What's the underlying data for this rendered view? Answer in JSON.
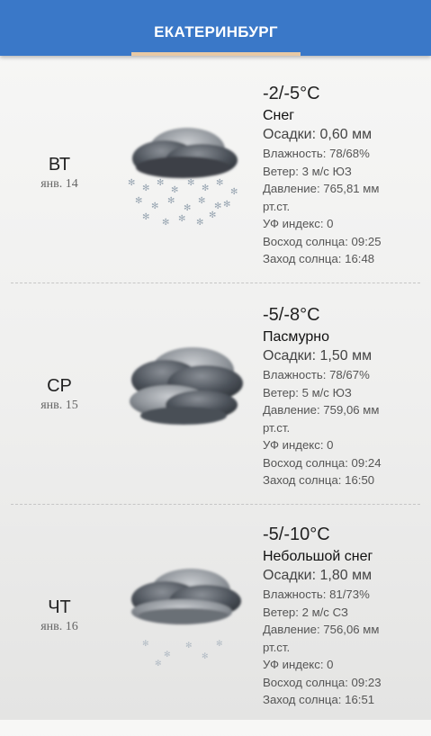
{
  "header": {
    "tab_label": "ЕКАТЕРИНБУРГ",
    "colors": {
      "bar": "#3a78c8",
      "indicator": "#e8c9a5"
    }
  },
  "days": [
    {
      "dow": "ВТ",
      "date": "янв. 14",
      "icon": "snow-cloud-icon",
      "temp": "-2/-5°C",
      "condition": "Снег",
      "precip": "Осадки: 0,60 мм",
      "humidity": "Влажность: 78/68%",
      "wind": "Ветер: 3 м/с ЮЗ",
      "pressure_1": "Давление: 765,81 мм",
      "pressure_2": "рт.ст.",
      "uv": "УФ индекс: 0",
      "sunrise": "Восход солнца:  09:25",
      "sunset": "Заход солнца:  16:48"
    },
    {
      "dow": "СР",
      "date": "янв. 15",
      "icon": "overcast-cloud-icon",
      "temp": "-5/-8°C",
      "condition": "Пасмурно",
      "precip": "Осадки: 1,50 мм",
      "humidity": "Влажность: 78/67%",
      "wind": "Ветер: 5 м/с ЮЗ",
      "pressure_1": "Давление: 759,06 мм",
      "pressure_2": "рт.ст.",
      "uv": "УФ индекс: 0",
      "sunrise": "Восход солнца:  09:24",
      "sunset": "Заход солнца:  16:50"
    },
    {
      "dow": "ЧТ",
      "date": "янв. 16",
      "icon": "light-snow-cloud-icon",
      "temp": "-5/-10°C",
      "condition": "Небольшой снег",
      "precip": "Осадки: 1,80 мм",
      "humidity": "Влажность: 81/73%",
      "wind": "Ветер: 2 м/с СЗ",
      "pressure_1": "Давление: 756,06 мм",
      "pressure_2": "рт.ст.",
      "uv": "УФ индекс: 0",
      "sunrise": "Восход солнца:  09:23",
      "sunset": "Заход солнца:  16:51"
    }
  ]
}
